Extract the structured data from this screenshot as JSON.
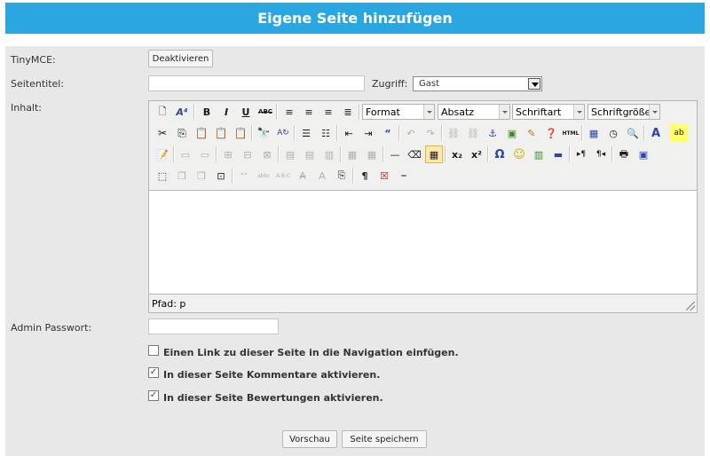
{
  "header": {
    "title": "Eigene Seite hinzufügen"
  },
  "form": {
    "tinymce_label": "TinyMCE:",
    "deactivate_label": "Deaktivieren",
    "title_label": "Seitentitel:",
    "title_value": "",
    "access_label": "Zugriff:",
    "access_value": "Gast",
    "content_label": "Inhalt:",
    "password_label": "Admin Passwort:",
    "password_value": ""
  },
  "editor": {
    "format_label": "Format",
    "paragraph_label": "Absatz",
    "font_label": "Schriftart",
    "fontsize_label": "Schriftgröße",
    "path_label": "Pfad: p",
    "icons": {
      "row1": [
        "new-document-icon",
        "styles-icon",
        "bold-icon",
        "italic-icon",
        "underline-icon",
        "strikethrough-icon",
        "align-left-icon",
        "align-center-icon",
        "align-right-icon",
        "justify-icon"
      ],
      "row2": [
        "cut-icon",
        "copy-icon",
        "paste-icon",
        "paste-text-icon",
        "paste-word-icon",
        "find-icon",
        "replace-icon",
        "bullet-list-icon",
        "numbered-list-icon",
        "outdent-icon",
        "indent-icon",
        "blockquote-icon",
        "undo-icon",
        "redo-icon",
        "link-icon",
        "unlink-icon",
        "anchor-icon",
        "image-icon",
        "cleanup-icon",
        "help-icon",
        "html-icon",
        "date-icon",
        "time-icon",
        "preview-icon",
        "font-color-icon",
        "highlight-icon"
      ],
      "row3": [
        "edit-icon",
        "table-row-icon",
        "table-col-icon",
        "table-split-icon",
        "table-merge-icon",
        "hr-icon",
        "eraser-icon",
        "table-icon",
        "subscript-icon",
        "superscript-icon",
        "omega-icon",
        "smiley-icon",
        "media-icon",
        "line-icon",
        "ltr-icon",
        "rtl-icon",
        "print-icon",
        "fullscreen-icon"
      ],
      "row4": [
        "layer-icon",
        "move-forward-icon",
        "move-backward-icon",
        "absolute-icon",
        "cite-icon",
        "abbr-icon",
        "acronym-icon",
        "del-icon",
        "ins-icon",
        "attribs-icon",
        "pilcrow-icon",
        "nonbreaking-icon",
        "pagebreak-icon"
      ]
    }
  },
  "options": [
    {
      "label": "Einen Link zu dieser Seite in die Navigation einfügen.",
      "checked": false,
      "mark": ""
    },
    {
      "label": "In dieser Seite Kommentare aktivieren.",
      "checked": true,
      "mark": "✓"
    },
    {
      "label": "In dieser Seite Bewertungen aktivieren.",
      "checked": true,
      "mark": "✓"
    }
  ],
  "actions": {
    "preview_label": "Vorschau",
    "save_label": "Seite speichern"
  }
}
